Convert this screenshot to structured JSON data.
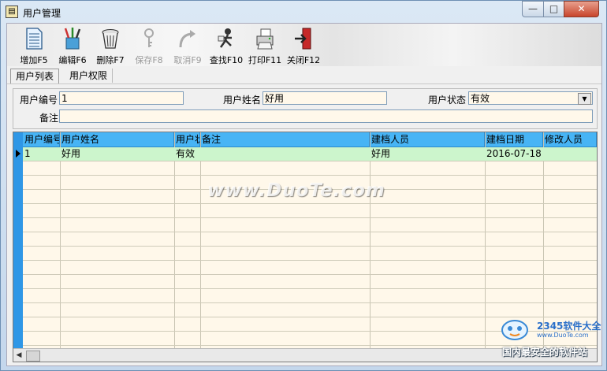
{
  "window": {
    "title": "用户管理",
    "minimize_glyph": "—",
    "maximize_glyph": "□",
    "close_glyph": "✕"
  },
  "toolbar": {
    "buttons": [
      {
        "label": "增加F5",
        "icon": "document-add-icon",
        "enabled": true
      },
      {
        "label": "编辑F6",
        "icon": "edit-pens-icon",
        "enabled": true
      },
      {
        "label": "删除F7",
        "icon": "trash-can-icon",
        "enabled": true
      },
      {
        "label": "保存F8",
        "icon": "save-keyhole-icon",
        "enabled": false
      },
      {
        "label": "取消F9",
        "icon": "undo-arrow-icon",
        "enabled": false
      },
      {
        "label": "查找F10",
        "icon": "find-person-icon",
        "enabled": true
      },
      {
        "label": "打印F11",
        "icon": "printer-icon",
        "enabled": true
      },
      {
        "label": "关闭F12",
        "icon": "exit-door-icon",
        "enabled": true
      }
    ]
  },
  "tabs": [
    {
      "label": "用户列表",
      "active": true
    },
    {
      "label": "用户权限",
      "active": false
    }
  ],
  "form": {
    "user_id_label": "用户编号",
    "user_id_value": "1",
    "user_name_label": "用户姓名",
    "user_name_value": "好用",
    "status_label": "用户状态",
    "status_value": "有效",
    "remark_label": "备注",
    "remark_value": ""
  },
  "grid": {
    "columns": [
      "用户编号",
      "用户姓名",
      "用户状",
      "备注",
      "建档人员",
      "建档日期",
      "修改人员"
    ],
    "rows": [
      [
        "1",
        "好用",
        "有效",
        "",
        "好用",
        "2016-07-18",
        ""
      ]
    ]
  },
  "watermark": {
    "text": "www.DuoTe.com"
  },
  "branding": {
    "name": "2345软件大全",
    "url": "www.DuoTe.com",
    "tagline": "国内最安全的软件站"
  },
  "colors": {
    "grid_header": "#47b4f5",
    "row_header": "#2f97e6",
    "selected_row": "#ccf5cc",
    "grid_background": "#fff8ea"
  }
}
